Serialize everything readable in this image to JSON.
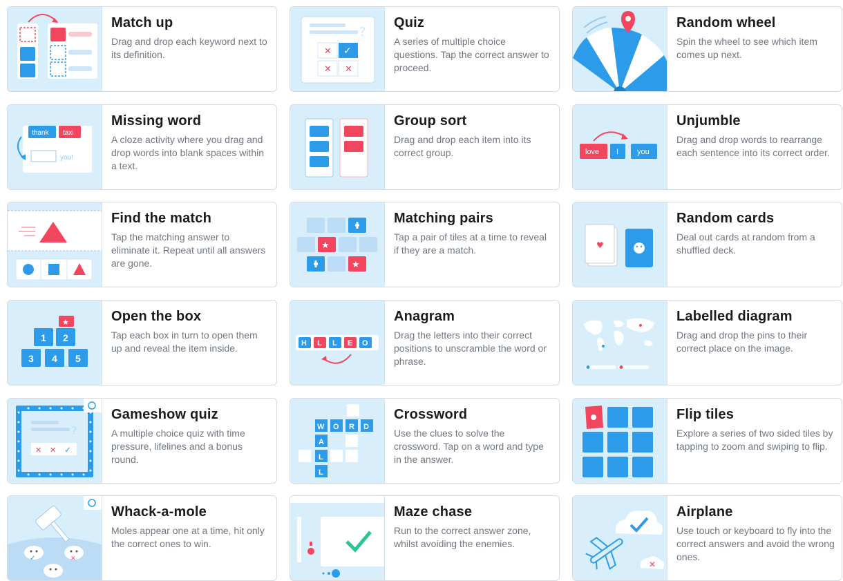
{
  "templates": [
    {
      "id": "match-up",
      "title": "Match up",
      "description": "Drag and drop each keyword next to its definition."
    },
    {
      "id": "quiz",
      "title": "Quiz",
      "description": "A series of multiple choice questions. Tap the correct answer to proceed."
    },
    {
      "id": "random-wheel",
      "title": "Random wheel",
      "description": "Spin the wheel to see which item comes up next."
    },
    {
      "id": "missing-word",
      "title": "Missing word",
      "description": "A cloze activity where you drag and drop words into blank spaces within a text.",
      "thumb_words": [
        "thank",
        "taxi",
        "you!"
      ]
    },
    {
      "id": "group-sort",
      "title": "Group sort",
      "description": "Drag and drop each item into its correct group."
    },
    {
      "id": "unjumble",
      "title": "Unjumble",
      "description": "Drag and drop words to rearrange each sentence into its correct order.",
      "thumb_words": [
        "love",
        "I",
        "you"
      ]
    },
    {
      "id": "find-the-match",
      "title": "Find the match",
      "description": "Tap the matching answer to eliminate it. Repeat until all answers are gone."
    },
    {
      "id": "matching-pairs",
      "title": "Matching pairs",
      "description": "Tap a pair of tiles at a time to reveal if they are a match."
    },
    {
      "id": "random-cards",
      "title": "Random cards",
      "description": "Deal out cards at random from a shuffled deck."
    },
    {
      "id": "open-the-box",
      "title": "Open the box",
      "description": "Tap each box in turn to open them up and reveal the item inside.",
      "thumb_numbers": [
        "1",
        "2",
        "3",
        "4",
        "5"
      ]
    },
    {
      "id": "anagram",
      "title": "Anagram",
      "description": "Drag the letters into their correct positions to unscramble the word or phrase.",
      "thumb_letters": [
        "H",
        "L",
        "L",
        "E",
        "O"
      ]
    },
    {
      "id": "labelled-diagram",
      "title": "Labelled diagram",
      "description": "Drag and drop the pins to their correct place on the image."
    },
    {
      "id": "gameshow-quiz",
      "title": "Gameshow quiz",
      "description": "A multiple choice quiz with time pressure, lifelines and a bonus round."
    },
    {
      "id": "crossword",
      "title": "Crossword",
      "description": "Use the clues to solve the crossword. Tap on a word and type in the answer.",
      "thumb_letters": [
        "W",
        "O",
        "R",
        "D",
        "A",
        "L",
        "L"
      ]
    },
    {
      "id": "flip-tiles",
      "title": "Flip tiles",
      "description": "Explore a series of two sided tiles by tapping to zoom and swiping to flip."
    },
    {
      "id": "whack-a-mole",
      "title": "Whack-a-mole",
      "description": "Moles appear one at a time, hit only the correct ones to win."
    },
    {
      "id": "maze-chase",
      "title": "Maze chase",
      "description": "Run to the correct answer zone, whilst avoiding the enemies."
    },
    {
      "id": "airplane",
      "title": "Airplane",
      "description": "Use touch or keyboard to fly into the correct answers and avoid the wrong ones."
    }
  ],
  "colors": {
    "blue": "#2b9bea",
    "red": "#f2465f",
    "thumb_bg": "#d9eefb",
    "title": "#1b1b1b",
    "text": "#707780"
  }
}
